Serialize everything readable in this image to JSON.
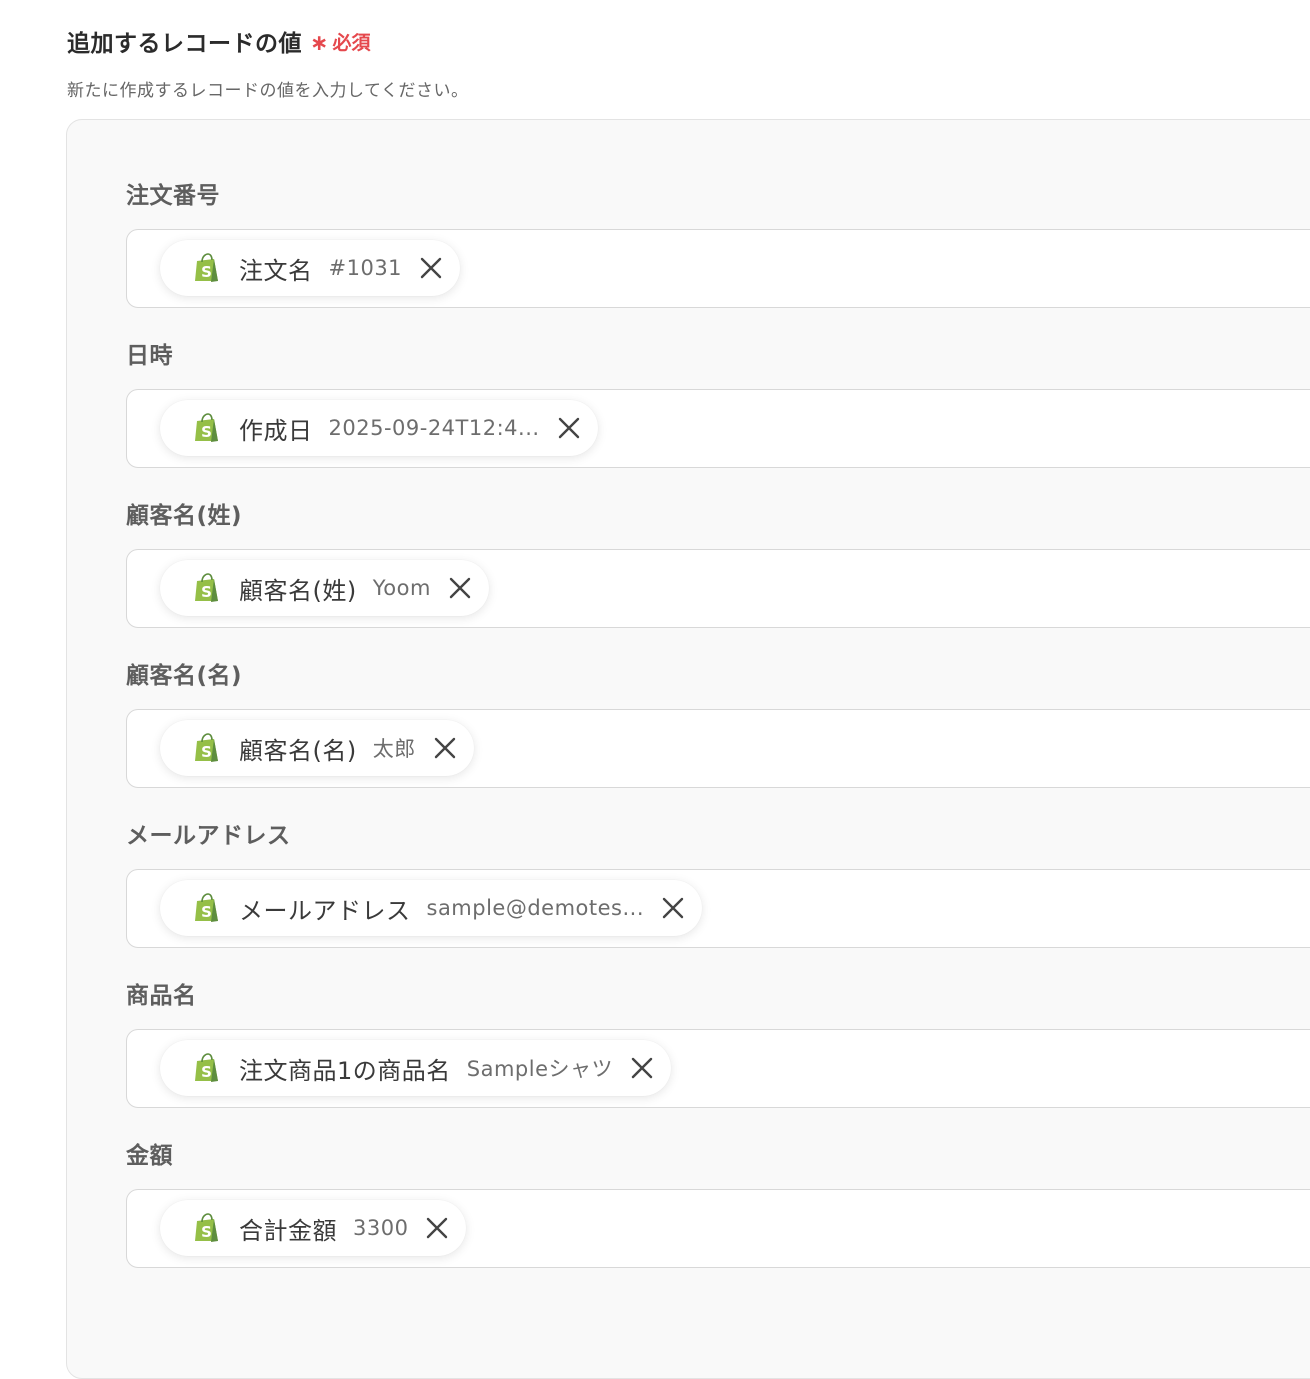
{
  "section": {
    "title": "追加するレコードの値",
    "required_mark": "∗",
    "required_label": "必須",
    "description": "新たに作成するレコードの値を入力してください。"
  },
  "fields": [
    {
      "label": "注文番号",
      "chip": {
        "name": "注文名",
        "value": "#1031",
        "icon": "shopify-icon"
      }
    },
    {
      "label": "日時",
      "chip": {
        "name": "作成日",
        "value": "2025-09-24T12:4...",
        "icon": "shopify-icon"
      }
    },
    {
      "label": "顧客名(姓)",
      "chip": {
        "name": "顧客名(姓)",
        "value": "Yoom",
        "icon": "shopify-icon"
      }
    },
    {
      "label": "顧客名(名)",
      "chip": {
        "name": "顧客名(名)",
        "value": "太郎",
        "icon": "shopify-icon"
      }
    },
    {
      "label": "メールアドレス",
      "chip": {
        "name": "メールアドレス",
        "value": "sample@demotes...",
        "icon": "shopify-icon"
      }
    },
    {
      "label": "商品名",
      "chip": {
        "name": "注文商品1の商品名",
        "value": "Sampleシャツ",
        "icon": "shopify-icon"
      }
    },
    {
      "label": "金額",
      "chip": {
        "name": "合計金額",
        "value": "3300",
        "icon": "shopify-icon"
      }
    }
  ],
  "colors": {
    "required": "#e5484d",
    "shopify_green": "#95bf47",
    "shopify_dark_green": "#5e8e3e"
  }
}
